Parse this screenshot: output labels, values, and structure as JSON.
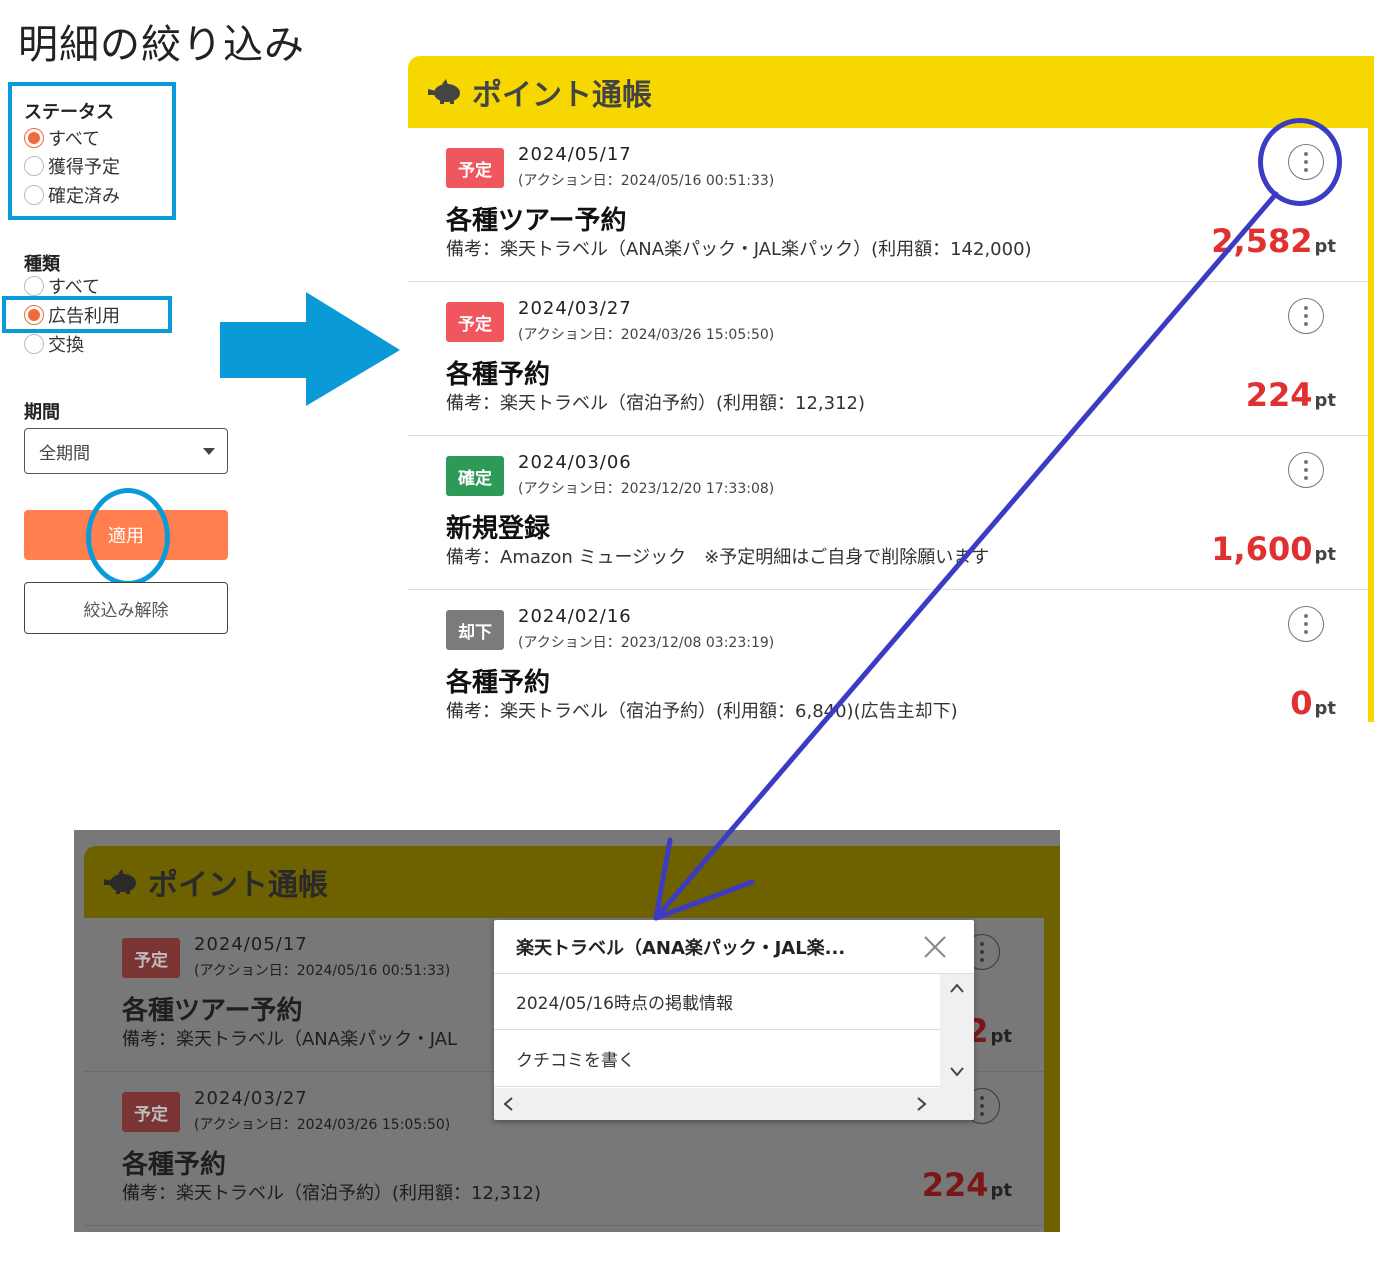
{
  "filter": {
    "title": "明細の絞り込み",
    "status": {
      "label": "ステータス",
      "options": [
        "すべて",
        "獲得予定",
        "確定済み"
      ],
      "selected": 0
    },
    "kind": {
      "label": "種類",
      "options": [
        "すべて",
        "広告利用",
        "交換"
      ],
      "selected": 1
    },
    "period": {
      "label": "期間",
      "value": "全期間"
    },
    "apply_label": "適用",
    "reset_label": "絞込み解除"
  },
  "passbook": {
    "title": "ポイント通帳",
    "entries": [
      {
        "badge": "予定",
        "badge_color": "#f0565d",
        "date": "2024/05/17",
        "action": "(アクション日：2024/05/16 00:51:33)",
        "title": "各種ツアー予約",
        "note": "備考：楽天トラベル（ANA楽パック・JAL楽パック）(利用額：142,000)",
        "points": "2,582",
        "unit": "pt"
      },
      {
        "badge": "予定",
        "badge_color": "#f0565d",
        "date": "2024/03/27",
        "action": "(アクション日：2024/03/26 15:05:50)",
        "title": "各種予約",
        "note": "備考：楽天トラベル（宿泊予約）(利用額：12,312)",
        "points": "224",
        "unit": "pt"
      },
      {
        "badge": "確定",
        "badge_color": "#2e9a58",
        "date": "2024/03/06",
        "action": "(アクション日：2023/12/20 17:33:08)",
        "title": "新規登録",
        "note": "備考：Amazon ミュージック　※予定明細はご自身で削除願います",
        "points": "1,600",
        "unit": "pt"
      },
      {
        "badge": "却下",
        "badge_color": "#7b7b7b",
        "date": "2024/02/16",
        "action": "(アクション日：2023/12/08 03:23:19)",
        "title": "各種予約",
        "note": "備考：楽天トラベル（宿泊予約）(利用額：6,840)(広告主却下)",
        "points": "0",
        "unit": "pt"
      }
    ]
  },
  "overlay": {
    "title": "ポイント通帳",
    "entries": [
      {
        "badge": "予定",
        "date": "2024/05/17",
        "action": "(アクション日：2024/05/16 00:51:33)",
        "title": "各種ツアー予約",
        "note": "備考：楽天トラベル（ANA楽パック・JAL",
        "points": "2",
        "unit": "pt"
      },
      {
        "badge": "予定",
        "date": "2024/03/27",
        "action": "(アクション日：2024/03/26 15:05:50)",
        "title": "各種予約",
        "note": "備考：楽天トラベル（宿泊予約）(利用額：12,312)",
        "points": "224",
        "unit": "pt"
      }
    ],
    "popup": {
      "title": "楽天トラベル（ANA楽パック・JAL楽...",
      "items": [
        "2024/05/16時点の掲載情報",
        "クチコミを書く"
      ]
    }
  },
  "colors": {
    "accent_yellow": "#f6d800",
    "apply_orange": "#ff7f4e",
    "highlight_blue": "#0a9ad8",
    "annotation_indigo": "#3b3bc4",
    "points_red": "#e03030"
  }
}
